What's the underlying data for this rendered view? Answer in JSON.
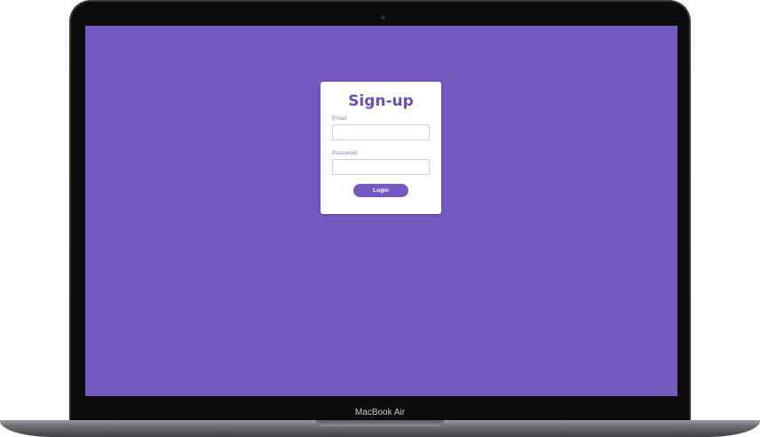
{
  "device": {
    "label": "MacBook Air"
  },
  "colors": {
    "accent": "#7459c1",
    "title": "#6a4fb6",
    "card": "#ffffff"
  },
  "signup": {
    "title": "Sign-up",
    "email_label": "Email",
    "email_value": "",
    "email_placeholder": "",
    "password_label": "Password",
    "password_value": "",
    "password_placeholder": "",
    "login_label": "Login"
  }
}
